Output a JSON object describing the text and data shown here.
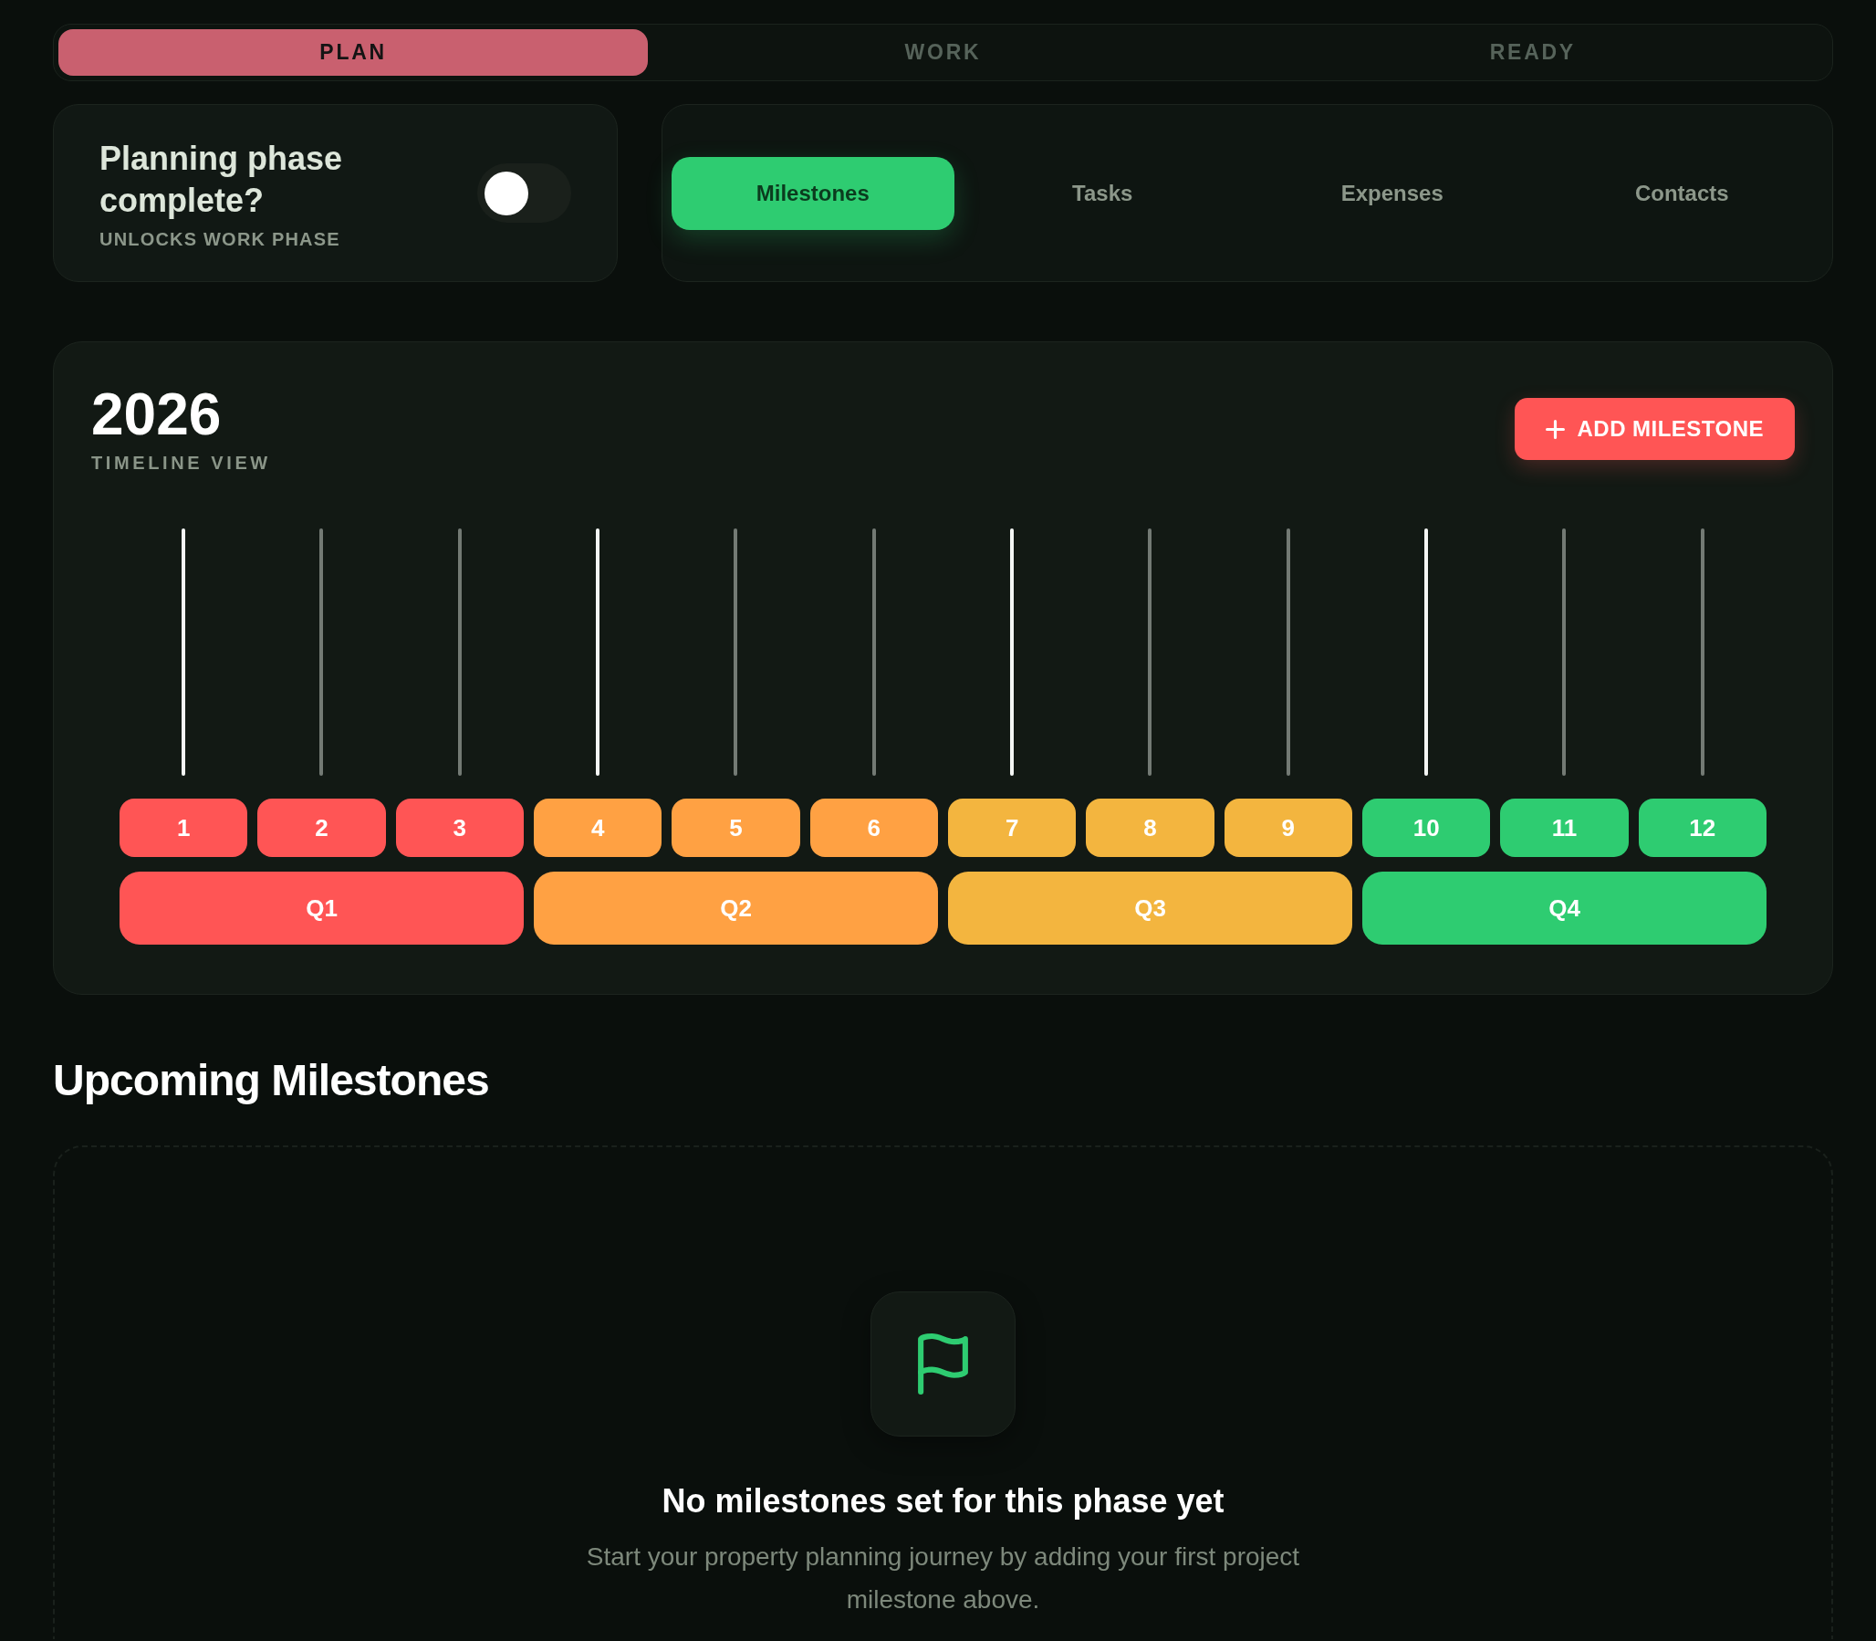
{
  "phase_tabs": [
    {
      "label": "PLAN",
      "selected": true
    },
    {
      "label": "WORK",
      "selected": false
    },
    {
      "label": "READY",
      "selected": false
    }
  ],
  "phase_toggle": {
    "title": "Planning phase complete?",
    "subtitle": "UNLOCKS WORK PHASE",
    "on": false
  },
  "section_tabs": [
    {
      "label": "Milestones",
      "selected": true
    },
    {
      "label": "Tasks",
      "selected": false
    },
    {
      "label": "Expenses",
      "selected": false
    },
    {
      "label": "Contacts",
      "selected": false
    }
  ],
  "timeline": {
    "year": "2026",
    "subtitle": "TIMELINE VIEW",
    "add_button": "ADD MILESTONE",
    "months": [
      {
        "label": "1",
        "color": "#ff5555",
        "highlighted": true
      },
      {
        "label": "2",
        "color": "#ff5555",
        "highlighted": false
      },
      {
        "label": "3",
        "color": "#ff5555",
        "highlighted": false
      },
      {
        "label": "4",
        "color": "#ffa143",
        "highlighted": true
      },
      {
        "label": "5",
        "color": "#ffa143",
        "highlighted": false
      },
      {
        "label": "6",
        "color": "#ffa143",
        "highlighted": false
      },
      {
        "label": "7",
        "color": "#f3b53f",
        "highlighted": true
      },
      {
        "label": "8",
        "color": "#f3b53f",
        "highlighted": false
      },
      {
        "label": "9",
        "color": "#f3b53f",
        "highlighted": false
      },
      {
        "label": "10",
        "color": "#2ecc71",
        "highlighted": true
      },
      {
        "label": "11",
        "color": "#2ecc71",
        "highlighted": false
      },
      {
        "label": "12",
        "color": "#2ecc71",
        "highlighted": false
      }
    ],
    "quarters": [
      {
        "label": "Q1",
        "color": "#ff5555"
      },
      {
        "label": "Q2",
        "color": "#ffa143"
      },
      {
        "label": "Q3",
        "color": "#f3b53f"
      },
      {
        "label": "Q4",
        "color": "#2ecc71"
      }
    ]
  },
  "upcoming": {
    "title": "Upcoming Milestones",
    "empty_title": "No milestones set for this phase yet",
    "empty_message": "Start your property planning journey by adding your first project milestone above."
  }
}
